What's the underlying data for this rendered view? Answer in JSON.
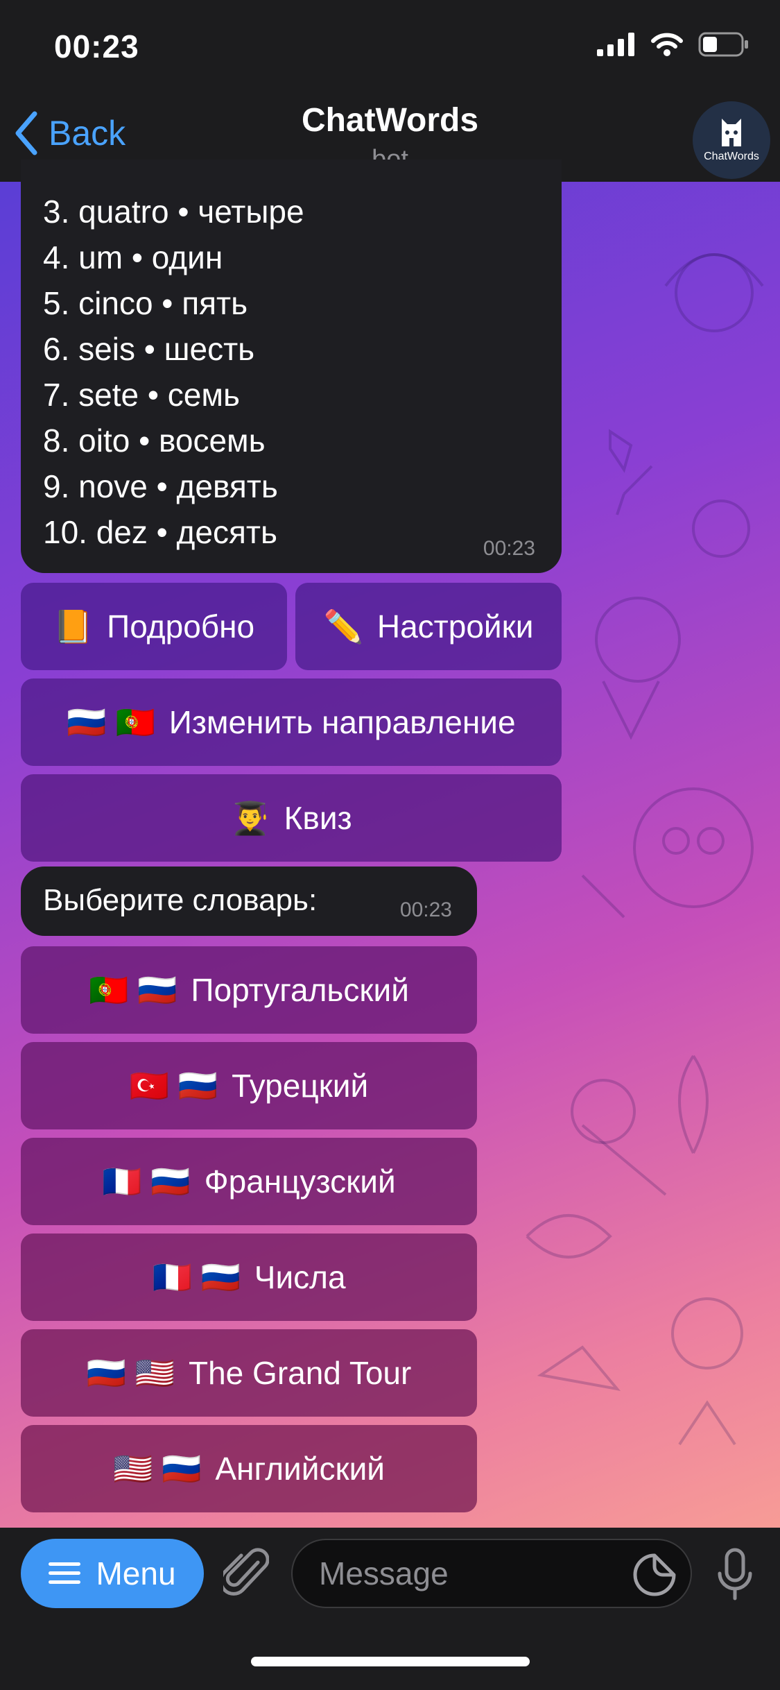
{
  "status_bar": {
    "time": "00:23"
  },
  "header": {
    "back_label": "Back",
    "title": "ChatWords",
    "subtitle": "bot",
    "avatar_label": "ChatWords"
  },
  "word_list": {
    "lines": [
      "3. quatro • четыре",
      "4. um • один",
      "5. cinco • пять",
      "6. seis • шесть",
      "7. sete • семь",
      "8. oito • восемь",
      "9. nove • девять",
      "10. dez • десять"
    ],
    "time": "00:23"
  },
  "keyboard_main": {
    "details": {
      "emoji": "📙",
      "label": "Подробно"
    },
    "settings": {
      "emoji": "✏️",
      "label": "Настройки"
    },
    "direction": {
      "emoji": "🇷🇺 🇵🇹",
      "label": "Изменить направление"
    },
    "quiz": {
      "emoji": "👨‍🎓",
      "label": "Квиз"
    }
  },
  "choose_message": {
    "text": "Выберите словарь:",
    "time": "00:23"
  },
  "dictionaries": [
    {
      "emoji": "🇵🇹 🇷🇺",
      "label": "Португальский"
    },
    {
      "emoji": "🇹🇷 🇷🇺",
      "label": "Турецкий"
    },
    {
      "emoji": "🇫🇷 🇷🇺",
      "label": "Французский"
    },
    {
      "emoji": "🇫🇷 🇷🇺",
      "label": "Числа"
    },
    {
      "emoji": "🇷🇺 🇺🇸",
      "label": "The Grand Tour"
    },
    {
      "emoji": "🇺🇸 🇷🇺",
      "label": "Английский"
    }
  ],
  "input_bar": {
    "menu_label": "Menu",
    "message_placeholder": "Message"
  },
  "colors": {
    "accent": "#3e96f4",
    "link": "#4aa3ff",
    "bubble": "#1e1e22",
    "bar": "#1c1c1e"
  }
}
